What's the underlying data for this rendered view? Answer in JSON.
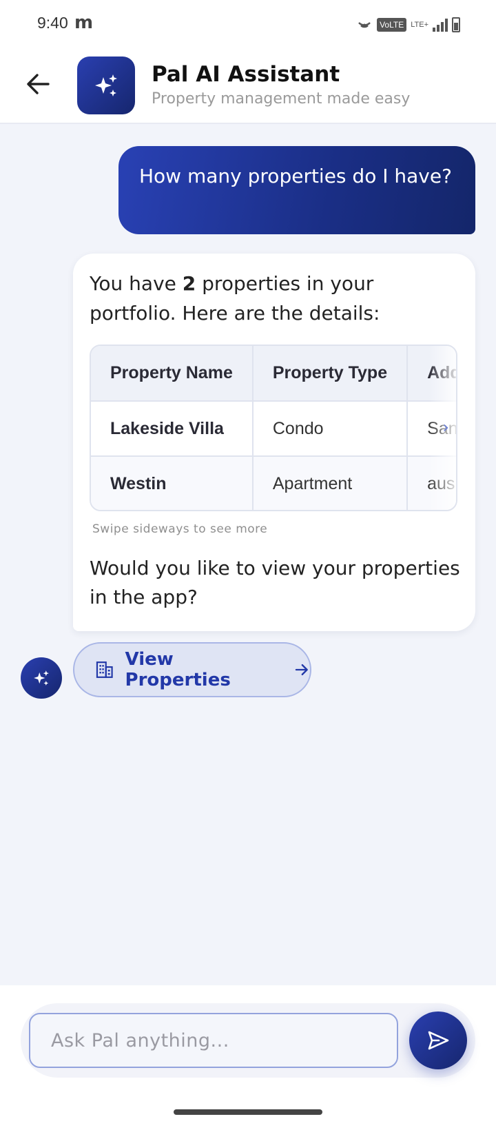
{
  "status_bar": {
    "time": "9:40",
    "carrier_glyph": "m",
    "volte": "VoLTE",
    "lte": "LTE+",
    "icons": [
      "hotspot-icon",
      "signal-icon",
      "battery-icon"
    ]
  },
  "header": {
    "title": "Pal AI Assistant",
    "subtitle": "Property management made easy",
    "back_icon": "arrow-left-icon",
    "logo_icon": "sparkles-icon"
  },
  "chat": {
    "user_message": "How many properties do I have?",
    "ai_intro_prefix": "You have ",
    "ai_intro_count": "2",
    "ai_intro_suffix": " properties in your portfolio. Here are the details:",
    "table": {
      "headers": [
        "Property Name",
        "Property Type",
        "Address"
      ],
      "rows": [
        [
          "Lakeside Villa",
          "Condo",
          "San"
        ],
        [
          "Westin",
          "Apartment",
          "aus"
        ]
      ]
    },
    "swipe_hint": "Swipe sideways to see more",
    "ai_question": "Would you like to view your properties in the app?",
    "action_button": "View Properties",
    "action_icon": "building-icon",
    "action_arrow": "arrow-right-icon"
  },
  "composer": {
    "placeholder": "Ask Pal anything...",
    "send_icon": "send-icon"
  },
  "colors": {
    "primary": "#1f34a0",
    "primary_dark": "#14266a",
    "background": "#f2f4fa",
    "button_bg": "#dfe4f4"
  }
}
